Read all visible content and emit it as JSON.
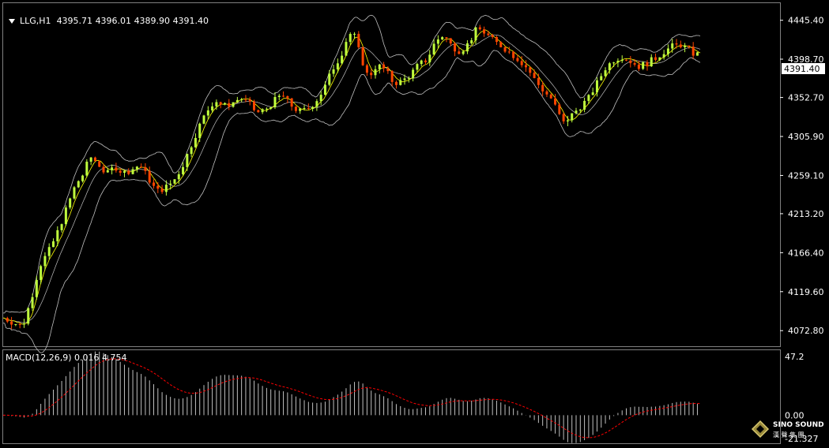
{
  "header": {
    "symbol": "LLG,H1",
    "open": "4395.71",
    "high": "4396.01",
    "low": "4389.90",
    "close": "4391.40"
  },
  "macd_header": {
    "label": "MACD(12,26,9)",
    "macd_value": "0.016",
    "signal_value": "4.754"
  },
  "price_axis_labels": [
    "4445.40",
    "4398.70",
    "4352.70",
    "4305.90",
    "4259.10",
    "4213.20",
    "4166.40",
    "4119.60",
    "4072.80"
  ],
  "current_price_tag": "4391.40",
  "macd_axis_labels": [
    "47.2",
    "0.00",
    "-21.327"
  ],
  "logo": {
    "text": "SINO SOUND",
    "subtext": "漢 聲 集 團"
  },
  "colors": {
    "background": "#000000",
    "bull_candle": "#c0ff3e",
    "bear_candle": "#ff4500",
    "bollinger": "#c0c0c0",
    "moving_average": "#ffff00",
    "macd_histogram": "#c0c0c0",
    "macd_signal": "#ff0000",
    "text": "#ffffff",
    "frame": "#808080"
  },
  "chart_data": {
    "type": "candlestick",
    "title": "LLG,H1",
    "ylim": [
      4055,
      4465
    ],
    "price_ticks": [
      4445.4,
      4398.7,
      4352.7,
      4305.9,
      4259.1,
      4213.2,
      4166.4,
      4119.6,
      4072.8
    ],
    "close_path": [
      [
        0,
        4088
      ],
      [
        8,
        4082
      ],
      [
        14,
        4078
      ],
      [
        20,
        4110
      ],
      [
        26,
        4150
      ],
      [
        34,
        4172
      ],
      [
        40,
        4195
      ],
      [
        46,
        4222
      ],
      [
        52,
        4248
      ],
      [
        58,
        4262
      ],
      [
        62,
        4282
      ],
      [
        68,
        4274
      ],
      [
        74,
        4260
      ],
      [
        80,
        4270
      ],
      [
        86,
        4262
      ],
      [
        92,
        4266
      ],
      [
        98,
        4272
      ],
      [
        104,
        4256
      ],
      [
        110,
        4240
      ],
      [
        116,
        4244
      ],
      [
        122,
        4252
      ],
      [
        128,
        4268
      ],
      [
        134,
        4292
      ],
      [
        140,
        4316
      ],
      [
        146,
        4336
      ],
      [
        152,
        4350
      ],
      [
        158,
        4342
      ],
      [
        164,
        4346
      ],
      [
        170,
        4352
      ],
      [
        176,
        4346
      ],
      [
        182,
        4334
      ],
      [
        188,
        4338
      ],
      [
        194,
        4348
      ],
      [
        200,
        4356
      ],
      [
        206,
        4344
      ],
      [
        212,
        4336
      ],
      [
        218,
        4338
      ],
      [
        224,
        4348
      ],
      [
        230,
        4362
      ],
      [
        236,
        4386
      ],
      [
        242,
        4402
      ],
      [
        248,
        4430
      ],
      [
        252,
        4426
      ],
      [
        256,
        4404
      ],
      [
        262,
        4376
      ],
      [
        268,
        4392
      ],
      [
        274,
        4386
      ],
      [
        280,
        4370
      ],
      [
        286,
        4372
      ],
      [
        292,
        4380
      ],
      [
        298,
        4392
      ],
      [
        304,
        4398
      ],
      [
        310,
        4420
      ],
      [
        316,
        4428
      ],
      [
        322,
        4414
      ],
      [
        328,
        4408
      ],
      [
        334,
        4418
      ],
      [
        340,
        4436
      ],
      [
        346,
        4430
      ],
      [
        352,
        4420
      ],
      [
        358,
        4414
      ],
      [
        364,
        4406
      ],
      [
        370,
        4398
      ],
      [
        376,
        4388
      ],
      [
        382,
        4372
      ],
      [
        388,
        4360
      ],
      [
        394,
        4350
      ],
      [
        398,
        4334
      ],
      [
        402,
        4322
      ],
      [
        408,
        4332
      ],
      [
        414,
        4342
      ],
      [
        420,
        4352
      ],
      [
        426,
        4370
      ],
      [
        432,
        4388
      ],
      [
        438,
        4398
      ],
      [
        444,
        4402
      ],
      [
        450,
        4396
      ],
      [
        456,
        4390
      ],
      [
        462,
        4394
      ],
      [
        468,
        4400
      ],
      [
        474,
        4408
      ],
      [
        480,
        4414
      ],
      [
        486,
        4416
      ],
      [
        492,
        4410
      ],
      [
        496,
        4404
      ],
      [
        500,
        4405
      ]
    ],
    "indicators": [
      "Bollinger Bands",
      "Moving Average"
    ],
    "macd": {
      "label": "MACD(12,26,9)",
      "macd": 0.016,
      "signal": 4.754,
      "ylim": [
        -21.327,
        47.2
      ]
    }
  }
}
